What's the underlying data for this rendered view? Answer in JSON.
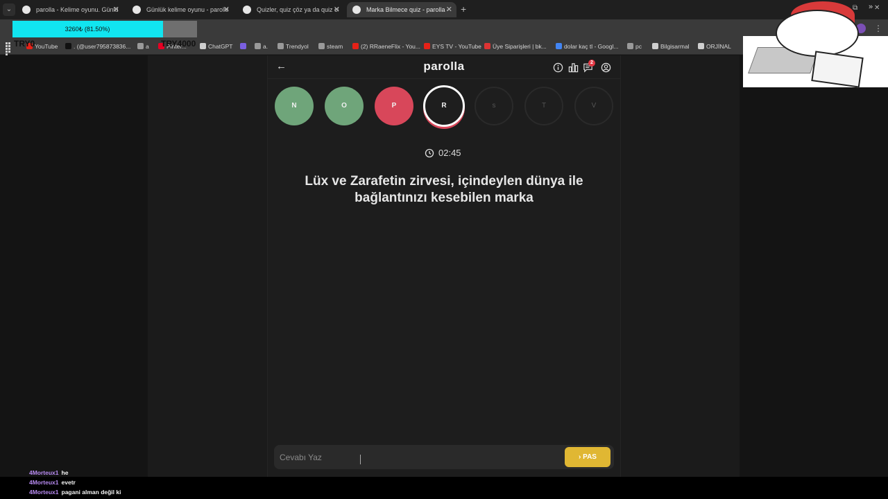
{
  "browser": {
    "tabs": [
      {
        "title": "parolla - Kelime oyunu. Günlük",
        "active": false
      },
      {
        "title": "Günlük kelime oyunu - parolla",
        "active": false
      },
      {
        "title": "Quizler, quiz çöz ya da quiz olu",
        "active": false
      },
      {
        "title": "Marka Bilmece quiz - parolla - İ",
        "active": true
      }
    ],
    "new_tab": "+",
    "window_controls": [
      "—",
      "⧉",
      "✕"
    ],
    "bookmarks": [
      {
        "label": "YouTube",
        "color": "#e62117"
      },
      {
        "label": ". (@user795873836...",
        "color": "#111111"
      },
      {
        "label": "a",
        "color": "#9a9a9a"
      },
      {
        "label": "Pinter...",
        "color": "#e60023"
      },
      {
        "label": "ChatGPT",
        "color": "#cfcfcf"
      },
      {
        "label": "",
        "color": "#7a5fe0"
      },
      {
        "label": "a.",
        "color": "#9a9a9a"
      },
      {
        "label": "Trendyol",
        "color": "#9a9a9a"
      },
      {
        "label": "steam",
        "color": "#9a9a9a"
      },
      {
        "label": "(2) RRaeneFlix - You...",
        "color": "#e62117"
      },
      {
        "label": "EYS TV - YouTube",
        "color": "#e62117"
      },
      {
        "label": "Üye Siparişleri | bk...",
        "color": "#d33"
      },
      {
        "label": "dolar kaç tl - Googl...",
        "color": "#4285f4"
      },
      {
        "label": "pc",
        "color": "#9a9a9a"
      },
      {
        "label": "Bilgisarmal",
        "color": "#cfcfcf"
      },
      {
        "label": "ORJİNAL",
        "color": "#cfcfcf"
      }
    ],
    "bookmarks_more": "»"
  },
  "donation_overlay": {
    "progress_text": "3260₺ (81.50%)",
    "progress_fraction": 0.815,
    "left_label": "TRY0",
    "right_label": "TRY4000"
  },
  "app": {
    "logo": "parolla",
    "badge_count": "2",
    "letters": [
      {
        "char": "N",
        "state": "correct"
      },
      {
        "char": "O",
        "state": "correct"
      },
      {
        "char": "P",
        "state": "wrong"
      },
      {
        "char": "R",
        "state": "current"
      },
      {
        "char": "s",
        "state": "pending"
      },
      {
        "char": "T",
        "state": "pending"
      },
      {
        "char": "V",
        "state": "pending"
      }
    ],
    "timer": "02:45",
    "question": "Lüx ve Zarafetin zirvesi, içindeylen dünya ile bağlantınızı kesebilen marka",
    "answer_placeholder": "Cevabı Yaz",
    "pas_label": "PAS",
    "pas_icon": "›"
  },
  "chat": [
    {
      "user": "4Morteux1",
      "message": "he"
    },
    {
      "user": "4Morteux1",
      "message": "evetr"
    },
    {
      "user": "4Morteux1",
      "message": "pagani alman değil ki"
    }
  ],
  "colors": {
    "correct": "#6fa57a",
    "wrong": "#d8475a",
    "pas_button": "#e0b733",
    "progress": "#11e5f0"
  }
}
